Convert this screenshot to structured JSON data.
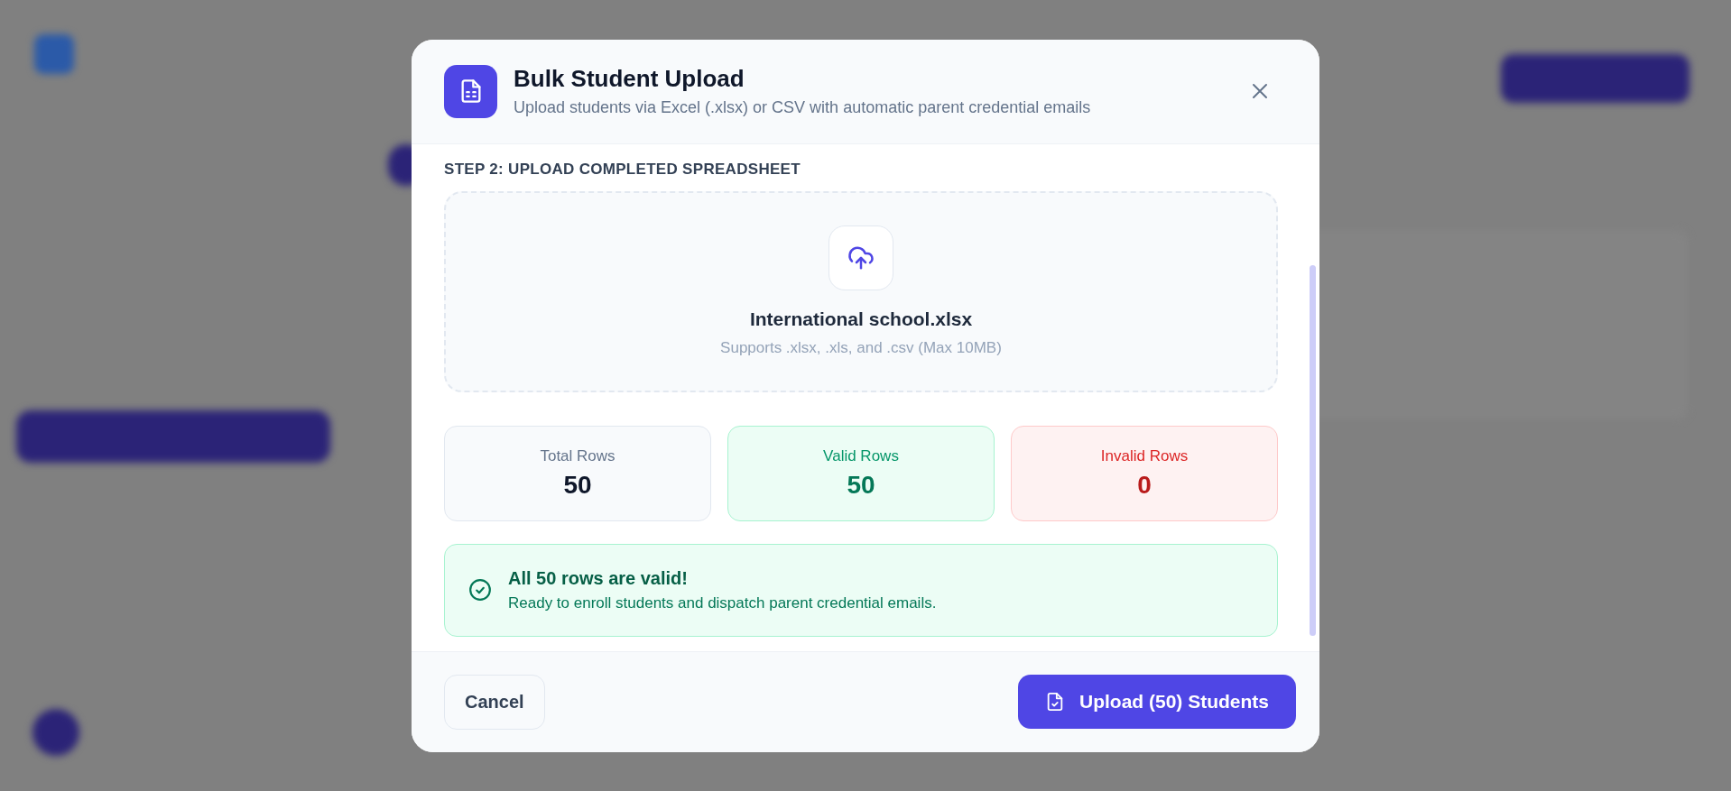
{
  "dialog": {
    "title": "Bulk Student Upload",
    "subtitle": "Upload students via Excel (.xlsx) or CSV with automatic parent credential emails",
    "step_label": "STEP 2: UPLOAD COMPLETED SPREADSHEET",
    "dropzone": {
      "file_name": "International school.xlsx",
      "hint": "Supports .xlsx, .xls, and .csv (Max 10MB)"
    },
    "stats": [
      {
        "kind": "total",
        "label": "Total Rows",
        "value": "50"
      },
      {
        "kind": "valid",
        "label": "Valid Rows",
        "value": "50"
      },
      {
        "kind": "invalid",
        "label": "Invalid Rows",
        "value": "0"
      }
    ],
    "alert": {
      "kind": "success",
      "title": "All 50 rows are valid!",
      "message": "Ready to enroll students and dispatch parent credential emails."
    },
    "buttons": {
      "cancel": "Cancel",
      "upload": "Upload (50) Students"
    }
  }
}
